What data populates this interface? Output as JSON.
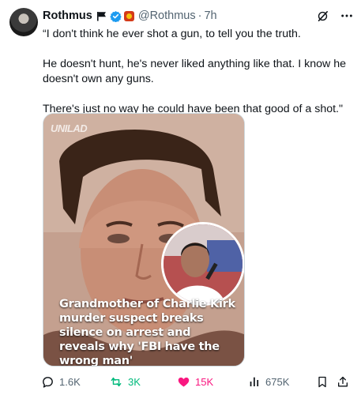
{
  "author": {
    "name": "Rothmus",
    "handle": "@Rothmus",
    "separator": "·",
    "time": "7h"
  },
  "icons": {
    "flag": "flag-icon",
    "verified": "verified-badge-icon",
    "org": "affiliate-badge-icon",
    "grok": "grok-icon",
    "more": "more-icon"
  },
  "tweet": {
    "paragraphs": [
      "“I don't think he ever shot a gun, to tell you the truth.",
      "He doesn't hunt, he's never liked anything like that. I know he doesn't own any guns.",
      "There's just no way he could have been that good of a shot.\""
    ]
  },
  "media": {
    "watermark": "UNILAD",
    "headline": "Grandmother of Charlie Kirk murder suspect breaks silence on arrest and reveals why 'FBI have the wrong man'"
  },
  "actions": {
    "replies": "1.6K",
    "reposts": "3K",
    "likes": "15K",
    "views": "675K"
  },
  "colors": {
    "text": "#0f1419",
    "muted": "#536471",
    "verified": "#1d9bf0",
    "repost_active": "#00ba7c",
    "like_active": "#f91880"
  }
}
